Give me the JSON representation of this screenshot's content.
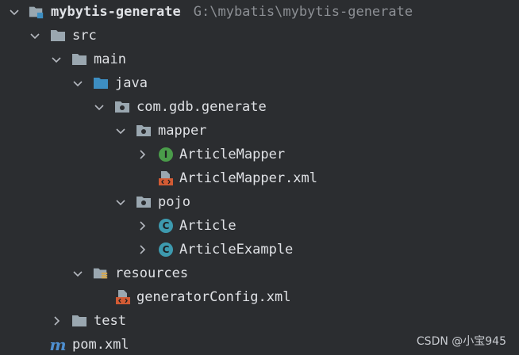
{
  "colors": {
    "background": "#2b2d30",
    "folder": "#9aa7b0",
    "source_folder": "#3d8ec2",
    "interface_badge": "#4a9c4a",
    "class_badge": "#3d9aaf",
    "xml_accent": "#d25b34",
    "maven_m": "#4e8fd0"
  },
  "tree": {
    "root": {
      "name": "mybytis-generate",
      "path": "G:\\mybatis\\mybytis-generate"
    },
    "src": "src",
    "main": "main",
    "java": "java",
    "package": "com.gdb.generate",
    "mapper": "mapper",
    "article_mapper": "ArticleMapper",
    "article_mapper_xml": "ArticleMapper.xml",
    "pojo": "pojo",
    "article": "Article",
    "article_example": "ArticleExample",
    "resources": "resources",
    "generator_config": "generatorConfig.xml",
    "test": "test",
    "pom": "pom.xml"
  },
  "badges": {
    "interface": "I",
    "class": "C",
    "maven": "m"
  },
  "watermark": "CSDN @小宝945"
}
